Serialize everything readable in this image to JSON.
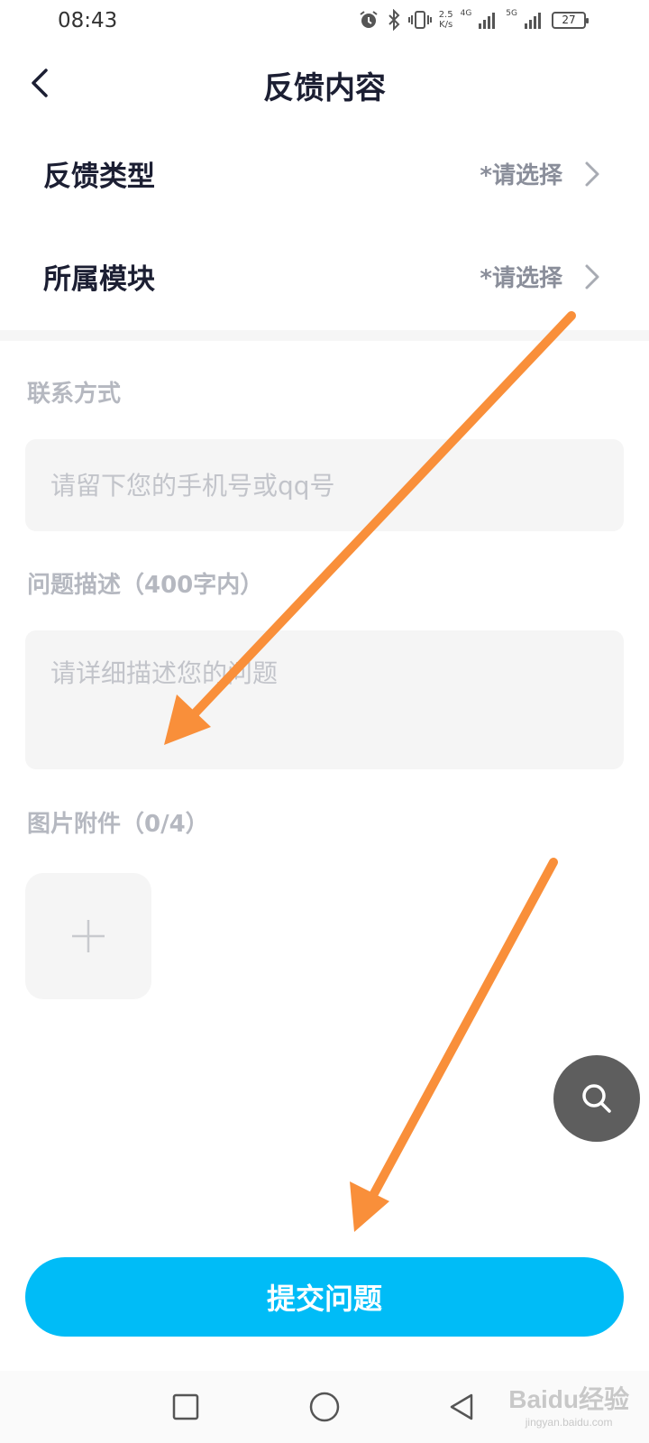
{
  "status_bar": {
    "time": "08:43",
    "speed_value": "2.5",
    "speed_unit": "K/s",
    "net1": "4G",
    "net2": "5G",
    "battery": "27"
  },
  "header": {
    "title": "反馈内容"
  },
  "feedback_type": {
    "label": "反馈类型",
    "value": "*请选择"
  },
  "module": {
    "label": "所属模块",
    "value": "*请选择"
  },
  "contact": {
    "label": "联系方式",
    "placeholder": "请留下您的手机号或qq号"
  },
  "description": {
    "label": "问题描述（400字内）",
    "placeholder": "请详细描述您的问题"
  },
  "attachments": {
    "label": "图片附件（0/4）"
  },
  "submit": {
    "label": "提交问题"
  },
  "watermark": {
    "logo": "Baidu经验",
    "sub": "jingyan.baidu.com"
  },
  "colors": {
    "accent": "#00bcf7",
    "arrow": "#f98f3a",
    "fab": "#5e5e5e"
  },
  "icons": [
    "back-arrow-icon",
    "chevron-right-icon",
    "plus-icon",
    "search-icon",
    "recent-apps-icon",
    "home-icon",
    "back-nav-icon",
    "alarm-icon",
    "bluetooth-icon",
    "vibrate-icon",
    "signal-icon",
    "battery-icon"
  ]
}
